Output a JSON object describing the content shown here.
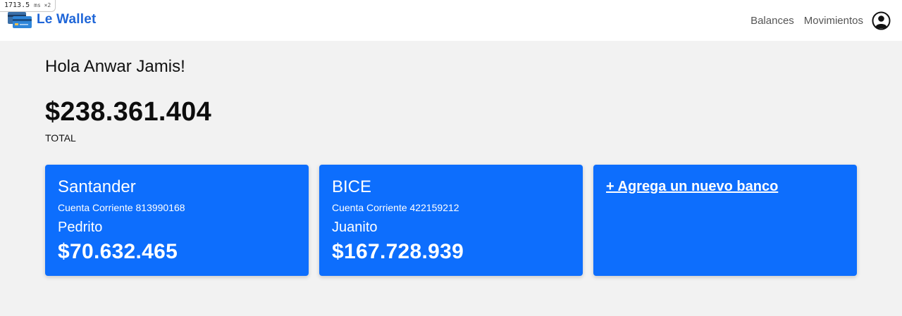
{
  "timing": {
    "value": "1713.5",
    "unit": "ms ×2"
  },
  "brand": {
    "name": "Le Wallet",
    "logo_icon": "credit-cards-icon",
    "color": "#1f66d8"
  },
  "nav": {
    "links": [
      "Balances",
      "Movimientos"
    ],
    "avatar_icon": "user-circle-icon"
  },
  "greeting": "Hola Anwar Jamis!",
  "total": {
    "amount": "$238.361.404",
    "label": "TOTAL"
  },
  "accent_color": "#0d6efd",
  "accounts": [
    {
      "bank": "Santander",
      "account": "Cuenta Corriente 813990168",
      "owner": "Pedrito",
      "balance": "$70.632.465"
    },
    {
      "bank": "BICE",
      "account": "Cuenta Corriente 422159212",
      "owner": "Juanito",
      "balance": "$167.728.939"
    }
  ],
  "add_bank_label": "+ Agrega un nuevo banco"
}
